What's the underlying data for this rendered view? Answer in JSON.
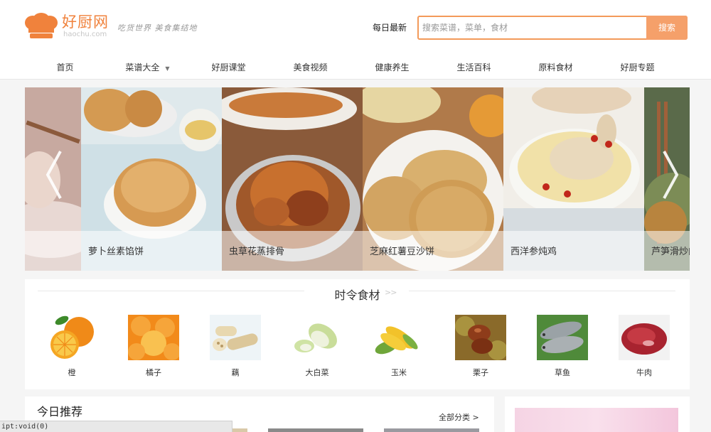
{
  "header": {
    "logo_text": "好厨网",
    "logo_sub": "haochu.com",
    "slogan": "吃货世界 美食集结地",
    "today_link": "每日最新",
    "search_placeholder": "搜索菜谱，菜单，食材",
    "search_button": "搜索"
  },
  "nav": [
    {
      "label": "首页"
    },
    {
      "label": "菜谱大全",
      "arrow": "▼"
    },
    {
      "label": "好厨课堂"
    },
    {
      "label": "美食视频"
    },
    {
      "label": "健康养生"
    },
    {
      "label": "生活百科"
    },
    {
      "label": "原料食材"
    },
    {
      "label": "好厨专题"
    }
  ],
  "carousel": {
    "slides": [
      {
        "caption": ""
      },
      {
        "caption": "萝卜丝素馅饼"
      },
      {
        "caption": "虫草花蒸排骨"
      },
      {
        "caption": "芝麻红薯豆沙饼"
      },
      {
        "caption": "西洋参炖鸡"
      },
      {
        "caption": "芦笋滑炒肉"
      }
    ]
  },
  "seasonal": {
    "title": "时令食材",
    "more": ">>",
    "items": [
      {
        "label": "橙",
        "icon": "orange-icon"
      },
      {
        "label": "橘子",
        "icon": "tangerine-icon"
      },
      {
        "label": "藕",
        "icon": "lotus-root-icon"
      },
      {
        "label": "大白菜",
        "icon": "cabbage-icon"
      },
      {
        "label": "玉米",
        "icon": "corn-icon"
      },
      {
        "label": "栗子",
        "icon": "chestnut-icon"
      },
      {
        "label": "草鱼",
        "icon": "fish-icon"
      },
      {
        "label": "牛肉",
        "icon": "beef-icon"
      }
    ]
  },
  "recommend": {
    "title": "今日推荐",
    "all_link": "全部分类 >"
  },
  "statusbar": {
    "text": "ipt:void(0)"
  },
  "colors": {
    "accent": "#f0823c",
    "search_border": "#f39a5a",
    "search_button": "#f5a06a"
  }
}
